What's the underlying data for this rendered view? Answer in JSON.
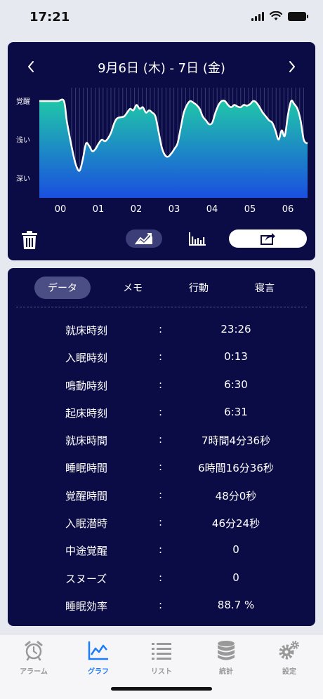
{
  "status": {
    "time": "17:21"
  },
  "chart": {
    "date_title": "9月6日 (木) - 7日 (金)",
    "prev_icon": "chevron-left-icon",
    "next_icon": "chevron-right-icon",
    "y_labels": [
      "覚醒",
      "浅い",
      "深い"
    ],
    "x_labels": [
      "00",
      "01",
      "02",
      "03",
      "04",
      "05",
      "06"
    ],
    "colors": {
      "card_bg": "#0b0b45",
      "fill_top": "#20c8a8",
      "fill_bottom": "#1a4fe0",
      "line": "#ffffff"
    }
  },
  "chart_data": {
    "type": "area",
    "title": "",
    "x_range": [
      "23:26",
      "06:31"
    ],
    "y_levels": [
      "深い",
      "浅い",
      "覚醒"
    ],
    "ylim": [
      0,
      100
    ],
    "series": [
      {
        "x": [
          "23:26",
          "23:40",
          "23:55",
          "00:05",
          "00:10",
          "00:20",
          "00:25",
          "00:30",
          "00:35",
          "00:40",
          "00:45",
          "00:50",
          "00:55",
          "01:00",
          "01:05",
          "01:10",
          "01:15",
          "01:20",
          "01:25",
          "01:30",
          "01:40",
          "01:45",
          "01:50",
          "01:55",
          "02:00",
          "02:05",
          "02:10",
          "02:15",
          "02:20",
          "02:25",
          "02:30",
          "02:35",
          "02:40",
          "02:45",
          "02:50",
          "02:55",
          "03:00",
          "03:05",
          "03:10",
          "03:15",
          "03:20",
          "03:25",
          "03:30",
          "03:35",
          "03:40",
          "03:45",
          "03:50",
          "03:55",
          "04:00",
          "04:05",
          "04:10",
          "04:15",
          "04:20",
          "04:25",
          "04:30",
          "04:35",
          "04:40",
          "04:45",
          "04:50",
          "04:55",
          "05:00",
          "05:05",
          "05:10",
          "05:15",
          "05:20",
          "05:25",
          "05:30",
          "05:35",
          "05:40",
          "05:45",
          "05:50",
          "05:55",
          "06:00",
          "06:05",
          "06:10",
          "06:15",
          "06:20",
          "06:25",
          "06:31"
        ],
        "values": [
          100,
          100,
          100,
          100,
          72,
          30,
          15,
          10,
          25,
          45,
          42,
          35,
          38,
          45,
          50,
          48,
          52,
          60,
          72,
          78,
          80,
          85,
          90,
          88,
          95,
          90,
          92,
          85,
          88,
          85,
          80,
          60,
          40,
          30,
          28,
          32,
          38,
          45,
          65,
          85,
          95,
          100,
          98,
          95,
          90,
          80,
          75,
          70,
          72,
          85,
          95,
          100,
          100,
          95,
          92,
          95,
          93,
          92,
          95,
          94,
          96,
          100,
          98,
          92,
          85,
          80,
          75,
          72,
          62,
          50,
          62,
          55,
          82,
          100,
          96,
          90,
          75,
          50,
          45
        ]
      }
    ]
  },
  "toolbar": {
    "trash_icon": "trash-icon",
    "graph_icon": "line-graph-icon",
    "bars_icon": "bar-graph-icon",
    "share_icon": "share-icon"
  },
  "tabs": [
    {
      "label": "データ",
      "active": true
    },
    {
      "label": "メモ",
      "active": false
    },
    {
      "label": "行動",
      "active": false
    },
    {
      "label": "寝言",
      "active": false
    }
  ],
  "rows": [
    {
      "label": "就床時刻",
      "value": "23:26"
    },
    {
      "label": "入眠時刻",
      "value": "0:13"
    },
    {
      "label": "鳴動時刻",
      "value": "6:30"
    },
    {
      "label": "起床時刻",
      "value": "6:31"
    },
    {
      "label": "就床時間",
      "value": "7時間4分36秒"
    },
    {
      "label": "睡眠時間",
      "value": "6時間16分36秒"
    },
    {
      "label": "覚醒時間",
      "value": "48分0秒"
    },
    {
      "label": "入眠潜時",
      "value": "46分24秒"
    },
    {
      "label": "中途覚醒",
      "value": "0"
    },
    {
      "label": "スヌーズ",
      "value": "0"
    },
    {
      "label": "睡眠効率",
      "value": "88.7 %"
    }
  ],
  "colon": ":",
  "tab_bar": [
    {
      "label": "アラーム",
      "icon": "alarm-clock-icon",
      "active": false
    },
    {
      "label": "グラフ",
      "icon": "graph-icon",
      "active": true
    },
    {
      "label": "リスト",
      "icon": "list-icon",
      "active": false
    },
    {
      "label": "統計",
      "icon": "database-icon",
      "active": false
    },
    {
      "label": "設定",
      "icon": "gear-icon",
      "active": false
    }
  ]
}
